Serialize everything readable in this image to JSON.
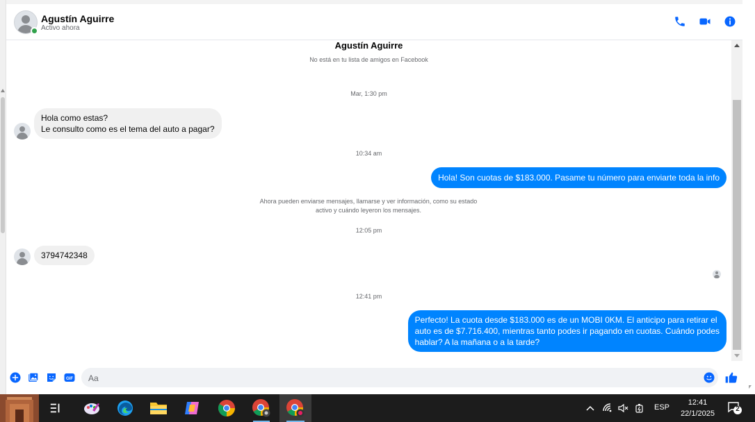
{
  "header": {
    "name": "Agustín Aguirre",
    "status": "Activo ahora"
  },
  "conversation": {
    "contact_name": "Agustín Aguirre",
    "contact_subtitle": "No está en tu lista de amigos en Facebook",
    "items": {
      "ts1": "Mar, 1:30 pm",
      "in1_line1": "Hola como estas?",
      "in1_line2": "Le consulto como es el tema del auto a pagar?",
      "ts2": "10:34 am",
      "out1": "Hola! Son cuotas de $183.000. Pasame tu número para enviarte toda la info",
      "notice_line1": "Ahora pueden enviarse mensajes, llamarse y ver información, como su estado",
      "notice_line2": "activo y cuándo leyeron los mensajes.",
      "ts3": "12:05 pm",
      "in2": "3794742348",
      "ts4": "12:41 pm",
      "out2_line1": "Perfecto! La cuota desde $183.000 es de un MOBI 0KM. El anticipo para retirar el",
      "out2_line2": "auto es de $7.716.400, mientras tanto podes ir pagando en cuotas. Cuándo podes",
      "out2_line3": "hablar? A la mañana o a la tarde?"
    }
  },
  "composer": {
    "placeholder": "Aa"
  },
  "taskbar": {
    "language": "ESP",
    "time": "12:41",
    "date": "22/1/2025",
    "notification_count": "2"
  },
  "colors": {
    "messenger_blue": "#0084ff",
    "icon_blue": "#0866ff",
    "online_green": "#31a24c",
    "incoming_bubble": "#f0f0f0"
  }
}
